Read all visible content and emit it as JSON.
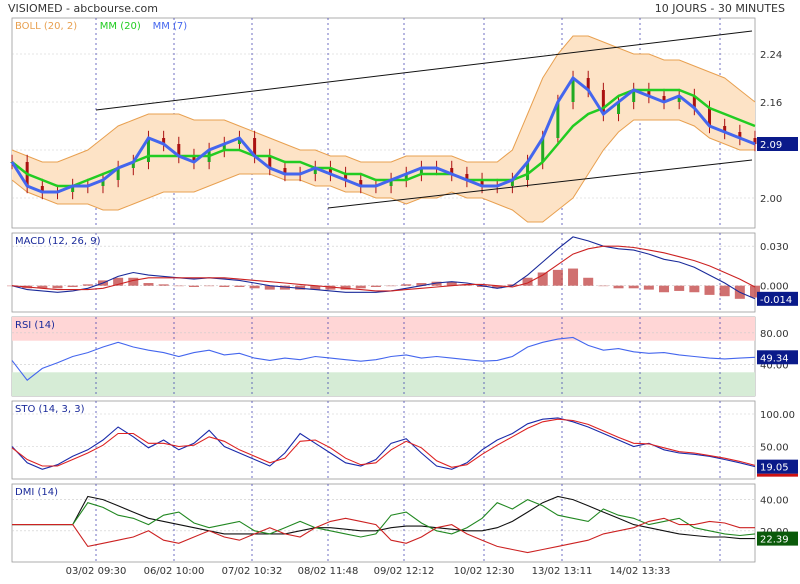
{
  "header": {
    "title": "VISIOMED - abcbourse.com",
    "period": "10 JOURS - 30 MINUTES"
  },
  "x_axis": {
    "labels": [
      "03/02 09:30",
      "06/02 10:00",
      "07/02 10:32",
      "08/02 11:48",
      "09/02 12:12",
      "10/02 12:30",
      "13/02 13:11",
      "14/02 13:33"
    ]
  },
  "colors": {
    "boll": "#e8a050",
    "boll_fill": "#fde3c6",
    "mm20": "#22cc22",
    "mm7": "#4466ee",
    "candle": "#aa1111",
    "macd_line": "#1a2a9a",
    "signal_line": "#cc2222",
    "hist": "#c04040",
    "rsi_upper": "#ffd6d6",
    "rsi_lower": "#d6ecd6",
    "sto_k": "#1a2aaa",
    "sto_d": "#dd2222",
    "dmi_adx": "#111111",
    "dmi_plus": "#228822",
    "dmi_minus": "#cc2222",
    "badge_blue": "#0a1a8a",
    "badge_green": "#0a5a0a",
    "grid": "#cccccc",
    "separator": "#3333aa"
  },
  "chart_data": [
    {
      "type": "line",
      "panel": "price",
      "legend": [
        "BOLL (20, 2)",
        "MM (20)",
        "MM (7)"
      ],
      "ylim": [
        1.95,
        2.3
      ],
      "yticks": [
        2.24,
        2.16,
        2.08,
        2.0
      ],
      "ytick_labels": [
        "2.24",
        "2.16",
        "",
        "2.00"
      ],
      "current_value": "2.09",
      "x": [
        0,
        10,
        20,
        30,
        40,
        50,
        60,
        70,
        80,
        90,
        100,
        110,
        120,
        130,
        140,
        150,
        160,
        170,
        180,
        190,
        200,
        210,
        220,
        230,
        240,
        250,
        260,
        270,
        280,
        290,
        300,
        310,
        320,
        330,
        340,
        350,
        360,
        370,
        380,
        390,
        400,
        410,
        420,
        430,
        440,
        450,
        460,
        470,
        480,
        490
      ],
      "series": [
        {
          "name": "MM (7)",
          "values": [
            2.06,
            2.02,
            2.01,
            2.01,
            2.02,
            2.02,
            2.03,
            2.05,
            2.06,
            2.1,
            2.09,
            2.07,
            2.06,
            2.08,
            2.09,
            2.1,
            2.07,
            2.05,
            2.04,
            2.04,
            2.05,
            2.04,
            2.03,
            2.02,
            2.02,
            2.03,
            2.04,
            2.05,
            2.05,
            2.04,
            2.03,
            2.02,
            2.02,
            2.03,
            2.06,
            2.1,
            2.16,
            2.2,
            2.18,
            2.14,
            2.16,
            2.18,
            2.17,
            2.16,
            2.17,
            2.15,
            2.12,
            2.11,
            2.1,
            2.09
          ]
        },
        {
          "name": "MM (20)",
          "values": [
            2.06,
            2.04,
            2.03,
            2.02,
            2.02,
            2.03,
            2.04,
            2.05,
            2.06,
            2.07,
            2.07,
            2.07,
            2.07,
            2.07,
            2.08,
            2.08,
            2.07,
            2.07,
            2.06,
            2.06,
            2.05,
            2.05,
            2.04,
            2.04,
            2.03,
            2.03,
            2.03,
            2.04,
            2.04,
            2.04,
            2.03,
            2.03,
            2.03,
            2.03,
            2.04,
            2.06,
            2.09,
            2.12,
            2.14,
            2.15,
            2.17,
            2.18,
            2.18,
            2.18,
            2.18,
            2.17,
            2.15,
            2.14,
            2.13,
            2.12
          ]
        },
        {
          "name": "BOLL upper",
          "values": [
            2.08,
            2.07,
            2.06,
            2.06,
            2.07,
            2.08,
            2.1,
            2.12,
            2.13,
            2.14,
            2.14,
            2.14,
            2.13,
            2.13,
            2.13,
            2.12,
            2.11,
            2.1,
            2.09,
            2.08,
            2.08,
            2.07,
            2.07,
            2.06,
            2.06,
            2.06,
            2.07,
            2.07,
            2.07,
            2.07,
            2.06,
            2.06,
            2.06,
            2.08,
            2.14,
            2.2,
            2.24,
            2.27,
            2.27,
            2.26,
            2.25,
            2.24,
            2.24,
            2.23,
            2.23,
            2.22,
            2.21,
            2.2,
            2.18,
            2.16
          ]
        },
        {
          "name": "BOLL lower",
          "values": [
            2.03,
            2.01,
            2.0,
            1.99,
            1.99,
            1.99,
            1.98,
            1.98,
            1.99,
            2.0,
            2.01,
            2.01,
            2.01,
            2.02,
            2.03,
            2.04,
            2.04,
            2.04,
            2.03,
            2.03,
            2.02,
            2.02,
            2.01,
            2.01,
            2.0,
            2.0,
            1.99,
            2.0,
            2.0,
            2.01,
            2.0,
            2.0,
            1.99,
            1.98,
            1.96,
            1.96,
            1.98,
            2.0,
            2.04,
            2.08,
            2.11,
            2.13,
            2.13,
            2.13,
            2.13,
            2.12,
            2.1,
            2.09,
            2.08,
            2.08
          ]
        }
      ]
    },
    {
      "type": "line",
      "panel": "macd",
      "legend": "MACD (12, 26, 9)",
      "ylim": [
        -0.02,
        0.04
      ],
      "yticks": [
        0.03,
        0.0
      ],
      "ytick_labels": [
        "0.030",
        "0.000"
      ],
      "current_value": "-0.014",
      "x": [
        0,
        10,
        20,
        30,
        40,
        50,
        60,
        70,
        80,
        90,
        100,
        110,
        120,
        130,
        140,
        150,
        160,
        170,
        180,
        190,
        200,
        210,
        220,
        230,
        240,
        250,
        260,
        270,
        280,
        290,
        300,
        310,
        320,
        330,
        340,
        350,
        360,
        370,
        380,
        390,
        400,
        410,
        420,
        430,
        440,
        450,
        460,
        470,
        480,
        490
      ],
      "series": [
        {
          "name": "MACD",
          "values": [
            0.0,
            -0.003,
            -0.004,
            -0.005,
            -0.004,
            -0.002,
            0.002,
            0.007,
            0.01,
            0.008,
            0.007,
            0.006,
            0.005,
            0.006,
            0.005,
            0.004,
            0.002,
            0.0,
            -0.001,
            -0.002,
            -0.003,
            -0.004,
            -0.005,
            -0.005,
            -0.005,
            -0.004,
            -0.002,
            0.0,
            0.002,
            0.003,
            0.002,
            0.0,
            -0.002,
            0.0,
            0.008,
            0.018,
            0.028,
            0.037,
            0.034,
            0.03,
            0.028,
            0.027,
            0.024,
            0.02,
            0.018,
            0.014,
            0.008,
            0.002,
            -0.005,
            -0.01
          ]
        },
        {
          "name": "Signal",
          "values": [
            0.0,
            -0.001,
            -0.002,
            -0.003,
            -0.003,
            -0.003,
            -0.002,
            0.001,
            0.004,
            0.006,
            0.006,
            0.006,
            0.006,
            0.006,
            0.006,
            0.005,
            0.004,
            0.003,
            0.002,
            0.001,
            0.0,
            -0.001,
            -0.002,
            -0.003,
            -0.004,
            -0.004,
            -0.003,
            -0.002,
            -0.001,
            0.0,
            0.001,
            0.001,
            0.0,
            -0.001,
            0.002,
            0.008,
            0.016,
            0.024,
            0.028,
            0.03,
            0.03,
            0.029,
            0.027,
            0.025,
            0.022,
            0.019,
            0.015,
            0.01,
            0.005,
            -0.001
          ]
        }
      ]
    },
    {
      "type": "line",
      "panel": "rsi",
      "legend": "RSI (14)",
      "ylim": [
        0,
        100
      ],
      "yticks": [
        80,
        40
      ],
      "ytick_labels": [
        "80.00",
        "40.00"
      ],
      "bands": {
        "upper": [
          70,
          100
        ],
        "lower": [
          0,
          30
        ]
      },
      "current_value": "49.34",
      "x": [
        0,
        10,
        20,
        30,
        40,
        50,
        60,
        70,
        80,
        90,
        100,
        110,
        120,
        130,
        140,
        150,
        160,
        170,
        180,
        190,
        200,
        210,
        220,
        230,
        240,
        250,
        260,
        270,
        280,
        290,
        300,
        310,
        320,
        330,
        340,
        350,
        360,
        370,
        380,
        390,
        400,
        410,
        420,
        430,
        440,
        450,
        460,
        470,
        480,
        490
      ],
      "series": [
        {
          "name": "RSI",
          "values": [
            45,
            20,
            35,
            42,
            50,
            55,
            62,
            68,
            62,
            58,
            55,
            50,
            55,
            58,
            52,
            54,
            48,
            45,
            48,
            46,
            50,
            48,
            46,
            44,
            46,
            50,
            52,
            48,
            50,
            48,
            46,
            44,
            45,
            50,
            62,
            68,
            72,
            74,
            64,
            58,
            60,
            56,
            54,
            55,
            52,
            50,
            48,
            47,
            48,
            49
          ]
        }
      ]
    },
    {
      "type": "line",
      "panel": "sto",
      "legend": "STO (14, 3, 3)",
      "ylim": [
        0,
        120
      ],
      "yticks": [
        100,
        50
      ],
      "ytick_labels": [
        "100.00",
        "50.00"
      ],
      "current_value": "19.05",
      "x": [
        0,
        10,
        20,
        30,
        40,
        50,
        60,
        70,
        80,
        90,
        100,
        110,
        120,
        130,
        140,
        150,
        160,
        170,
        180,
        190,
        200,
        210,
        220,
        230,
        240,
        250,
        260,
        270,
        280,
        290,
        300,
        310,
        320,
        330,
        340,
        350,
        360,
        370,
        380,
        390,
        400,
        410,
        420,
        430,
        440,
        450,
        460,
        470,
        480,
        490
      ],
      "series": [
        {
          "name": "%K",
          "values": [
            50,
            25,
            15,
            22,
            35,
            45,
            60,
            80,
            65,
            48,
            60,
            45,
            55,
            75,
            50,
            40,
            30,
            20,
            40,
            70,
            55,
            40,
            25,
            20,
            30,
            55,
            62,
            40,
            20,
            15,
            25,
            45,
            60,
            70,
            85,
            92,
            94,
            88,
            80,
            70,
            60,
            50,
            55,
            45,
            40,
            38,
            35,
            30,
            25,
            19
          ]
        },
        {
          "name": "%D",
          "values": [
            48,
            30,
            20,
            20,
            30,
            40,
            52,
            70,
            70,
            55,
            55,
            50,
            52,
            65,
            58,
            45,
            35,
            25,
            32,
            58,
            60,
            48,
            32,
            22,
            25,
            45,
            58,
            48,
            28,
            18,
            22,
            38,
            52,
            65,
            78,
            88,
            92,
            90,
            84,
            74,
            64,
            55,
            54,
            48,
            42,
            40,
            36,
            32,
            27,
            21
          ]
        }
      ]
    },
    {
      "type": "line",
      "panel": "dmi",
      "legend": "DMI (14)",
      "ylim": [
        0,
        50
      ],
      "yticks": [
        40,
        20
      ],
      "ytick_labels": [
        "40.00",
        "20.00"
      ],
      "current_value": "22.39",
      "x": [
        0,
        10,
        20,
        30,
        40,
        50,
        60,
        70,
        80,
        90,
        100,
        110,
        120,
        130,
        140,
        150,
        160,
        170,
        180,
        190,
        200,
        210,
        220,
        230,
        240,
        250,
        260,
        270,
        280,
        290,
        300,
        310,
        320,
        330,
        340,
        350,
        360,
        370,
        380,
        390,
        400,
        410,
        420,
        430,
        440,
        450,
        460,
        470,
        480,
        490
      ],
      "series": [
        {
          "name": "ADX",
          "values": [
            24,
            24,
            24,
            24,
            24,
            42,
            40,
            36,
            32,
            28,
            26,
            24,
            22,
            20,
            18,
            18,
            18,
            18,
            18,
            20,
            22,
            22,
            21,
            20,
            20,
            22,
            23,
            23,
            22,
            21,
            20,
            20,
            22,
            26,
            32,
            38,
            42,
            40,
            36,
            32,
            28,
            24,
            22,
            20,
            18,
            17,
            16,
            16,
            15,
            15
          ]
        },
        {
          "name": "+DI",
          "values": [
            24,
            24,
            24,
            24,
            24,
            38,
            35,
            30,
            28,
            24,
            30,
            32,
            25,
            22,
            24,
            26,
            20,
            18,
            22,
            26,
            22,
            20,
            18,
            16,
            18,
            30,
            32,
            25,
            20,
            18,
            22,
            28,
            38,
            34,
            40,
            36,
            30,
            28,
            26,
            34,
            30,
            28,
            24,
            26,
            28,
            22,
            20,
            18,
            17,
            18
          ]
        },
        {
          "name": "-DI",
          "values": [
            24,
            24,
            24,
            24,
            24,
            10,
            12,
            14,
            16,
            20,
            14,
            12,
            16,
            20,
            16,
            14,
            18,
            22,
            18,
            16,
            22,
            26,
            28,
            26,
            24,
            14,
            12,
            16,
            22,
            24,
            18,
            14,
            10,
            8,
            6,
            8,
            10,
            12,
            14,
            18,
            20,
            22,
            26,
            28,
            24,
            24,
            26,
            25,
            22,
            22
          ]
        }
      ]
    }
  ]
}
